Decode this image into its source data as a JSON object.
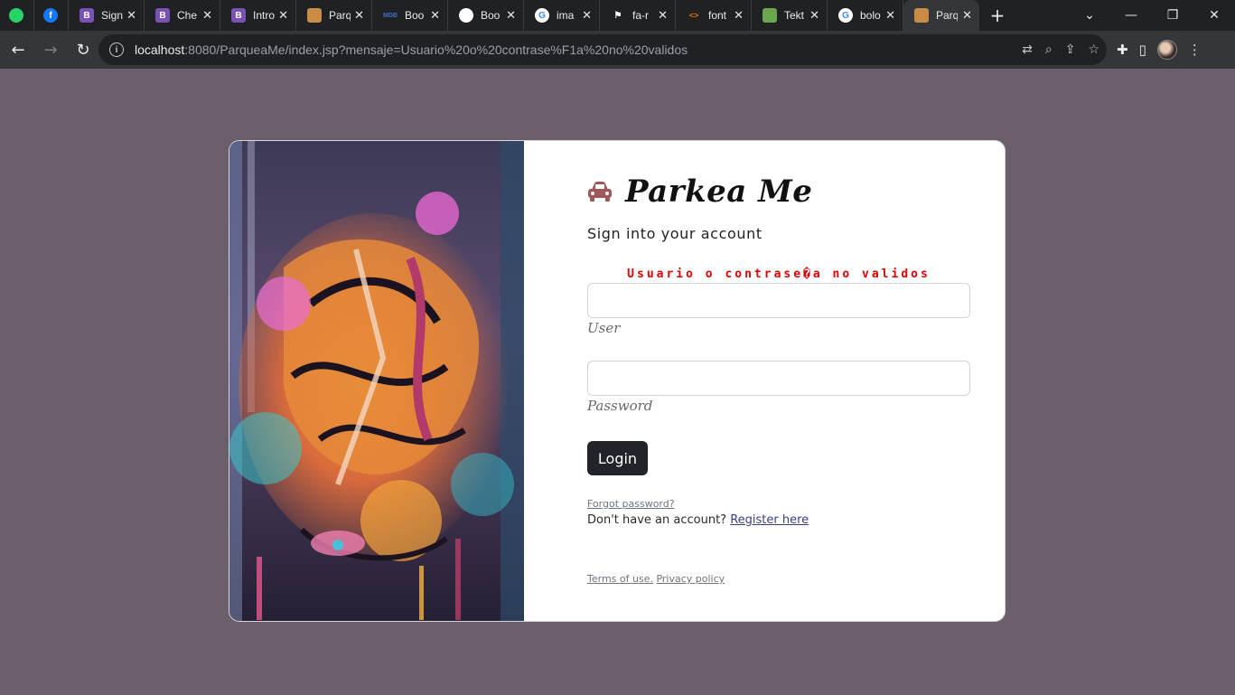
{
  "browser": {
    "tabs": [
      {
        "title": "",
        "favicon": "whatsapp-icon",
        "color": "#25d366",
        "single": true
      },
      {
        "title": "",
        "favicon": "facebook-icon",
        "color": "#1877f2",
        "single": true
      },
      {
        "title": "Sign",
        "favicon": "bootstrap-icon",
        "color": "#7952b3"
      },
      {
        "title": "Che",
        "favicon": "bootstrap-icon",
        "color": "#7952b3"
      },
      {
        "title": "Intro",
        "favicon": "bootstrap-icon",
        "color": "#7952b3"
      },
      {
        "title": "Parq",
        "favicon": "parkea-icon",
        "color": "#c98b45"
      },
      {
        "title": "Boo",
        "favicon": "mdb-icon",
        "color": "#3b71ca"
      },
      {
        "title": "Boo",
        "favicon": "github-icon",
        "color": "#ffffff"
      },
      {
        "title": "ima",
        "favicon": "google-icon",
        "color": "#4285f4"
      },
      {
        "title": "fa-r",
        "favicon": "flag-icon",
        "color": "#ffffff"
      },
      {
        "title": "font",
        "favicon": "code-icon",
        "color": "#e8710a"
      },
      {
        "title": "Tekt",
        "favicon": "tekton-icon",
        "color": "#6aa84f"
      },
      {
        "title": "bolo",
        "favicon": "google-icon",
        "color": "#4285f4"
      },
      {
        "title": "Parq",
        "favicon": "parkea-icon",
        "color": "#c98b45",
        "active": true
      }
    ],
    "new_tab": "+",
    "url_host": "localhost",
    "url_rest": ":8080/ParqueaMe/index.jsp?mensaje=Usuario%20o%20contrase%F1a%20no%20validos"
  },
  "login": {
    "brand_icon": "car-icon",
    "brand_title": "Parkea Me",
    "subtitle": "Sign into your account",
    "error_message": "Usuario o contrase�a no validos",
    "user_label": "User",
    "user_value": "",
    "password_label": "Password",
    "password_value": "",
    "login_button": "Login",
    "forgot_password": "Forgot password?",
    "register_prefix": "Don't have an account? ",
    "register_link": "Register here",
    "terms": "Terms of use.",
    "privacy": "Privacy policy"
  },
  "colors": {
    "page_bg": "#6b5f6b",
    "error": "#e00000",
    "button": "#212529",
    "brand_icon": "#a0575c"
  }
}
